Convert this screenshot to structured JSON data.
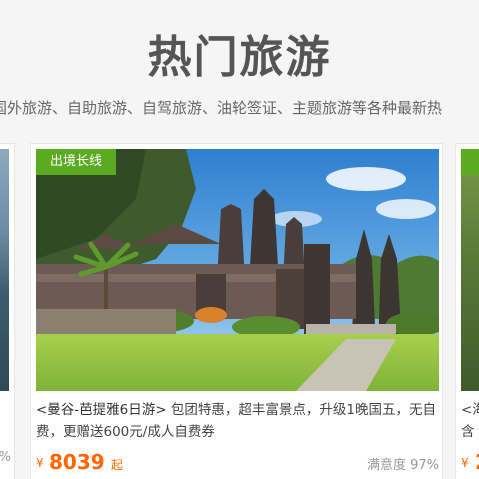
{
  "section": {
    "title": "热门旅游",
    "subtitle": "国外旅游、自助旅游、自驾旅游、油轮签证、主题旅游等各种最新热"
  },
  "cards": {
    "left": {
      "satisfaction_tail": "%"
    },
    "main": {
      "ribbon": "出境长线",
      "name": "<曼谷-芭提雅6日游>",
      "description": " 包团特惠，超丰富景点，升级1晚国五，无自费，更赠送600元/成人自费券",
      "currency": "¥",
      "price": "8039",
      "price_suffix": "起",
      "satisfaction": "满意度 97%",
      "image_icon": "temple-photo"
    },
    "right": {
      "ribbon": "",
      "desc_line1": "<海",
      "desc_line2": "含",
      "currency": "¥",
      "price": "2"
    }
  },
  "colors": {
    "accent_green": "#5bab22",
    "price_orange": "#ff6600",
    "title_gray": "#555555"
  }
}
